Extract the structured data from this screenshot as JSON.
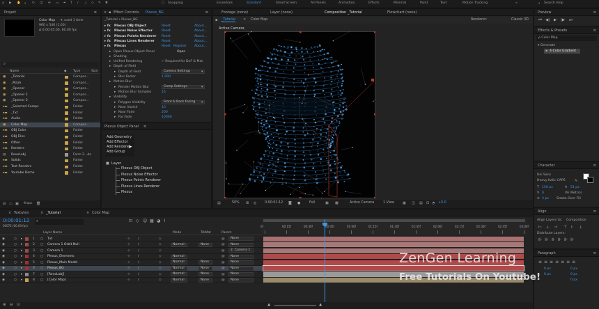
{
  "toolbar": {
    "snapping": "Snapping",
    "workspaces": [
      "Essentials",
      "Standard",
      "Small Screen",
      "All Panels",
      "Animation",
      "Effects",
      "Minimal",
      "Paint",
      "Text",
      "Motion Tracking"
    ],
    "search": "Search Help"
  },
  "project": {
    "title": "Project",
    "comp_name": "Color Map",
    "comp_info": "▾, used 1 time",
    "comp_size": "960 x 540 (1.00)",
    "comp_dur": "Δ 0:00:05:00, 60.00 fps",
    "col_name": "Name",
    "col_type": "Type",
    "col_size": "Size",
    "items": [
      {
        "name": "_Tutorial",
        "type": "Compos...",
        "color": "#c9a34a",
        "kind": "comp"
      },
      {
        "name": "_Maze",
        "type": "Compos...",
        "color": "#c9a34a",
        "kind": "comp"
      },
      {
        "name": "_Opener",
        "type": "Compos...",
        "color": "#c9a34a",
        "kind": "comp"
      },
      {
        "name": "_Opener 2",
        "type": "Compos...",
        "color": "#c9a34a",
        "kind": "comp"
      },
      {
        "name": "_Opener 3",
        "type": "Compos...",
        "color": "#c9a34a",
        "kind": "comp"
      },
      {
        "name": "_Selected Comps",
        "type": "Folder",
        "color": "#c9a34a",
        "kind": "folder"
      },
      {
        "name": "_Txt",
        "type": "Folder",
        "color": "#c9a34a",
        "kind": "folder"
      },
      {
        "name": "Audio",
        "type": "Folder",
        "color": "#c9a34a",
        "kind": "folder"
      },
      {
        "name": "Color Map",
        "type": "Compos...",
        "color": "#c9a34a",
        "kind": "comp",
        "selected": true
      },
      {
        "name": "OBJ Color",
        "type": "Folder",
        "color": "#c9a34a",
        "kind": "folder"
      },
      {
        "name": "OBJ Files",
        "type": "Folder",
        "color": "#c9a34a",
        "kind": "folder"
      },
      {
        "name": "Other",
        "type": "Folder",
        "color": "#c9a34a",
        "kind": "folder"
      },
      {
        "name": "Renders",
        "type": "Folder",
        "color": "#c9a34a",
        "kind": "folder"
      },
      {
        "name": "RevoLobj",
        "type": "Form 2...de",
        "color": "#9a9a9a",
        "kind": "file"
      },
      {
        "name": "Solids",
        "type": "Folder",
        "color": "#c9a34a",
        "kind": "folder"
      },
      {
        "name": "Test Renders",
        "type": "Folder",
        "color": "#c9a34a",
        "kind": "folder"
      },
      {
        "name": "Youtube Demo",
        "type": "Folder",
        "color": "#c9a34a",
        "kind": "folder"
      }
    ],
    "bpc": "8 bpc"
  },
  "effects": {
    "title": "Effect Controls",
    "layer": "Plexus_BG",
    "path": "_Tutorial • Plexus_BG",
    "rows": [
      {
        "indent": 0,
        "label": "Plexus OBJ Object",
        "reset": "Reset",
        "about": "About...",
        "fx": true
      },
      {
        "indent": 0,
        "label": "Plexus Noise Effector",
        "reset": "Reset",
        "about": "About...",
        "fx": true
      },
      {
        "indent": 0,
        "label": "Plexus Points Renderer",
        "reset": "Reset",
        "about": "About...",
        "fx": true
      },
      {
        "indent": 0,
        "label": "Plexus Lines Renderer",
        "reset": "Reset",
        "about": "About...",
        "fx": true
      },
      {
        "indent": 0,
        "label": "Plexus",
        "reset": "Reset",
        "register": "Register",
        "about": "About...",
        "fx": true
      },
      {
        "indent": 1,
        "label": "Open Plexus Object Panel",
        "value": "Open",
        "btn": true
      },
      {
        "indent": 1,
        "label": "Shading"
      },
      {
        "indent": 1,
        "label": "Unified Rendering",
        "value": "✓ Required for DoF & Mot",
        "check": true
      },
      {
        "indent": 1,
        "label": "Depth of Field"
      },
      {
        "indent": 2,
        "label": "Depth of Field",
        "value": "Camera Settings",
        "dd": true
      },
      {
        "indent": 2,
        "label": "Blur Factor",
        "value": "1.000",
        "blue": true
      },
      {
        "indent": 1,
        "label": "Motion Blur"
      },
      {
        "indent": 2,
        "label": "Render Motion Blur",
        "value": "Comp Settings",
        "dd": true
      },
      {
        "indent": 2,
        "label": "Motion Blur Samples",
        "value": "16",
        "blue": true
      },
      {
        "indent": 1,
        "label": "Visibility"
      },
      {
        "indent": 2,
        "label": "Polygon Visibility",
        "value": "Front & Back Facing",
        "dd": true
      },
      {
        "indent": 2,
        "label": "Near Vanish",
        "value": "10",
        "blue": true
      },
      {
        "indent": 2,
        "label": "Near Fade",
        "value": "200",
        "blue": true
      },
      {
        "indent": 2,
        "label": "Far Fade",
        "value": "10000",
        "blue": true
      }
    ]
  },
  "plexus_panel": {
    "title": "Plexus Object Panel",
    "menu": [
      "Add Geometry",
      "Add Effector",
      "Add Renderer",
      "Add Group"
    ],
    "layer": "Layer",
    "items": [
      "Plexus OBJ Object",
      "Plexus Noise Effector",
      "Plexus Points Renderer",
      "Plexus Lines Renderer",
      "Plexus"
    ]
  },
  "viewer": {
    "tabs": [
      "Footage (none)",
      "Layer (none)",
      "Composition _Tutorial",
      "Flowchart (none)"
    ],
    "active_tab": 2,
    "comp_tabs": [
      "_Tutorial",
      "Color Map"
    ],
    "renderer": "Renderer:",
    "renderer_val": "Classic 3D",
    "camera_label": "Active Camera",
    "zoom": "50%",
    "timecode": "0:00:01:12",
    "quality": "Full",
    "camera": "Active Camera",
    "views": "1 View",
    "exposure": "+0.0"
  },
  "preview": {
    "title": "Preview"
  },
  "fx_presets": {
    "title": "Effects & Presets",
    "search": "ρ Color Map",
    "category": "▾ Generate",
    "item": "4-Color Gradient"
  },
  "character": {
    "title": "Character",
    "font": "Uni Sans",
    "style": "Heavy Italic CAPS",
    "size": "150 px",
    "leading": "51 px",
    "tracking": "0",
    "kerning": "Metrics",
    "stroke": "3 px",
    "stroke_type": "Stroke Over Fill"
  },
  "align": {
    "title": "Align",
    "align_to_label": "Align Layers to:",
    "align_to": "Composition",
    "distribute": "Distribute Layers:"
  },
  "paragraph": {
    "title": "Paragraph",
    "values": [
      "0 px",
      "0 px",
      "0 px",
      "0 px",
      "0 px"
    ]
  },
  "timeline": {
    "tabs": [
      "Textuten",
      "_Tutorial",
      "Color Map"
    ],
    "active_tab": 1,
    "timecode": "0:00:01:12",
    "frames": "00072 (60.00 fps)",
    "cols": {
      "layer_name": "Layer Name",
      "mode": "Mode",
      "trkmat": "TrkMat",
      "parent": "Parent"
    },
    "ruler": [
      "0f",
      "00:15f",
      "00:30f",
      "00:45f",
      "01:00f",
      "01:15f",
      "01:30f",
      "01:45f",
      "02:00f",
      "02:15f",
      "02:30f",
      "02:45f",
      "03:00f"
    ],
    "layers": [
      {
        "num": "1",
        "name": "Txt",
        "mode": "",
        "trk": "",
        "parent": "None",
        "label": "#9a4a4a",
        "bar": "#a87070",
        "sel": false
      },
      {
        "num": "2",
        "name": "Camera 1 Orbit Null",
        "mode": "Normal",
        "trk": "None",
        "parent": "None",
        "label": "#9a4a4a",
        "bar": "#a87878",
        "sel": false
      },
      {
        "num": "3",
        "name": "Camera 1",
        "mode": "",
        "trk": "",
        "parent": "2. Camera 1",
        "label": "#9a4a4a",
        "bar": "#a87878",
        "sel": false
      },
      {
        "num": "4",
        "name": "Plexus_Elements",
        "mode": "Normal",
        "trk": "",
        "parent": "None",
        "label": "#a03030",
        "bar": "#b04a4a",
        "sel": false
      },
      {
        "num": "5",
        "name": "Plexus_Main Model",
        "mode": "Normal",
        "trk": "None",
        "parent": "None",
        "label": "#a03030",
        "bar": "#b04a4a",
        "sel": false
      },
      {
        "num": "6",
        "name": "Plexus_BG",
        "mode": "Normal",
        "trk": "None",
        "parent": "None",
        "label": "#a03030",
        "bar": "#b04a4a",
        "sel": true
      },
      {
        "num": "7",
        "name": "[RevoLobj]",
        "mode": "Normal",
        "trk": "None",
        "parent": "None",
        "label": "#888888",
        "bar": "#9a9a9a",
        "sel": false
      },
      {
        "num": "8",
        "name": "[Color Map]",
        "mode": "Normal",
        "trk": "None",
        "parent": "None",
        "label": "#c9a34a",
        "bar": "#9a8a6a",
        "sel": false
      }
    ]
  },
  "watermark": {
    "line1": "ZenGen Learning",
    "line2": "Free Tutorials On Youtube!"
  }
}
